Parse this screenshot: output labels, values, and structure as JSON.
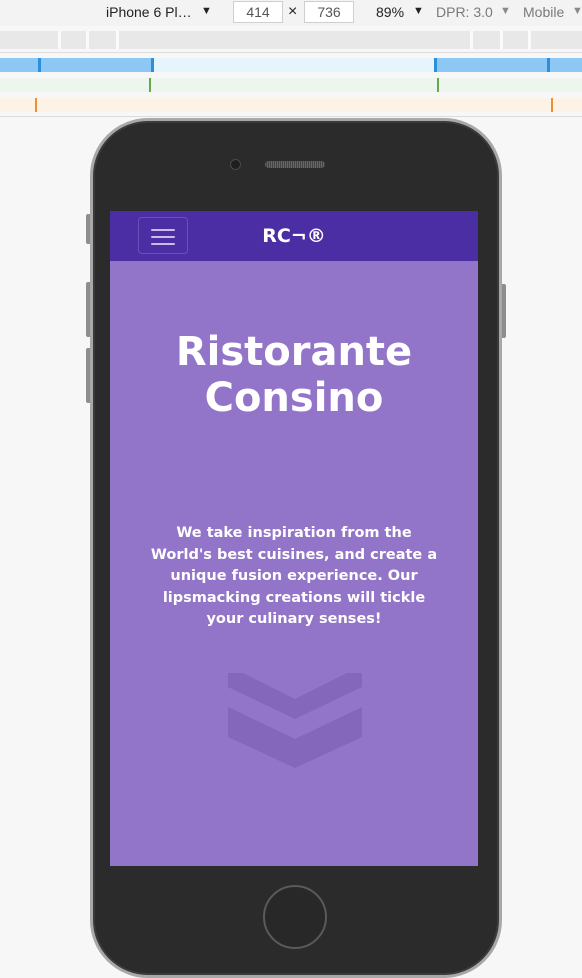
{
  "devtools": {
    "device": "iPhone 6 Pl…",
    "width": "414",
    "height": "736",
    "times": "×",
    "zoom": "89%",
    "dpr": "DPR: 3.0",
    "mode": "Mobile",
    "arrow": "▼"
  },
  "site": {
    "brand": "RC¬®",
    "title_line1": "Ristorante",
    "title_line2": "Consino",
    "tagline": "We take inspiration from the World's best cuisines, and create a unique fusion experience. Our lipsmacking creations will tickle your culinary senses!",
    "icons": {
      "menu": "hamburger-menu-icon",
      "scroll": "chevron-down-icon"
    }
  },
  "colors": {
    "navbar": "#4b2ea3",
    "hero": "#9275c8",
    "chevron": "#8466ba"
  }
}
